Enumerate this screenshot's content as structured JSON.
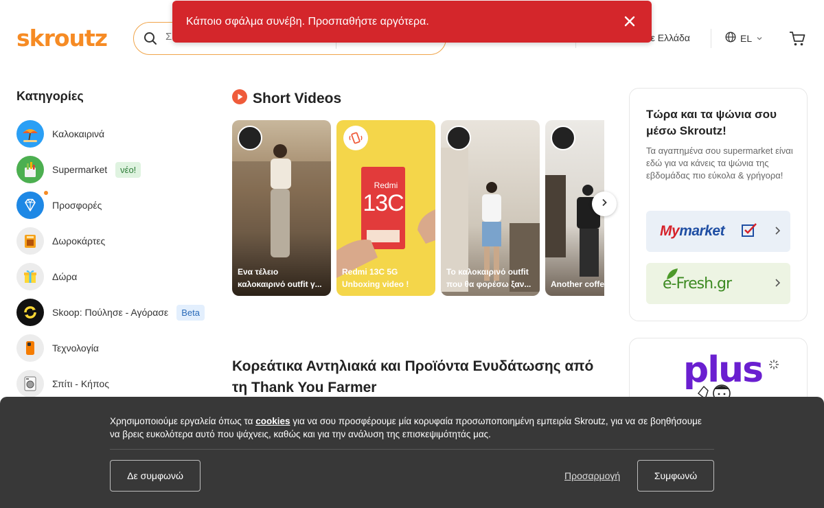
{
  "header": {
    "logo": "skroutz",
    "search_placeholder": "Σ",
    "shipping_text": "σε Ελλάδα",
    "language": "EL"
  },
  "toast": {
    "message": "Κάποιο σφάλμα συνέβη. Προσπαθήστε αργότερα."
  },
  "sidebar": {
    "title": "Κατηγορίες",
    "items": [
      {
        "label": "Καλοκαιρινά",
        "icon": "umbrella-icon"
      },
      {
        "label": "Supermarket",
        "icon": "grocery-bag-icon",
        "badge": "νέο!"
      },
      {
        "label": "Προσφορές",
        "icon": "diamond-icon"
      },
      {
        "label": "Δωροκάρτες",
        "icon": "gift-card-icon"
      },
      {
        "label": "Δώρα",
        "icon": "gift-icon"
      },
      {
        "label": "Skoop: Πούλησε - Αγόρασε",
        "icon": "skoop-icon",
        "badge": "Beta"
      },
      {
        "label": "Τεχνολογία",
        "icon": "phone-icon"
      },
      {
        "label": "Σπίτι - Κήπος",
        "icon": "washing-machine-icon"
      }
    ]
  },
  "short_videos": {
    "title": "Short Videos",
    "videos": [
      {
        "caption": "Ενα τέλειο\nκαλοκαιρινό outfit γ..."
      },
      {
        "caption": "Redmi 13C 5G\nUnboxing video !",
        "product_brand": "Redmi",
        "product_model": "13C"
      },
      {
        "caption": "Το καλοκαιρινό outfit\nπου θα φορέσω ξαν..."
      },
      {
        "caption": "Another coffee"
      }
    ]
  },
  "section_heading": "Κορεάτικα Αντηλιακά και Προϊόντα Ενυδάτωσης από τη Thank You Farmer",
  "promo": {
    "title": "Τώρα και τα ψώνια σου μέσω Skroutz!",
    "description": "Τα αγαπημένα σου supermarket είναι εδώ για να κάνεις τα ψώνια της εβδομάδας πιο εύκολα & γρήγορα!",
    "stores": [
      {
        "name": "My market"
      },
      {
        "name": "e-Fresh.gr"
      }
    ]
  },
  "plus": {
    "label": "plus"
  },
  "cookie_banner": {
    "text_before": "Χρησιμοποιούμε εργαλεία όπως τα ",
    "link": "cookies",
    "text_after": " για να σου προσφέρουμε μία κορυφαία προσωποποιημένη εμπειρία Skroutz, για να σε βοηθήσουμε να βρεις ευκολότερα αυτό που ψάχνεις, καθώς και για την ανάλυση της επισκεψιμότητάς μας.",
    "decline": "Δε συμφωνώ",
    "customize": "Προσαρμογή",
    "accept": "Συμφωνώ"
  },
  "colors": {
    "brand": "#f68b24",
    "error": "#d4262b",
    "plus": "#6a1fd0"
  }
}
